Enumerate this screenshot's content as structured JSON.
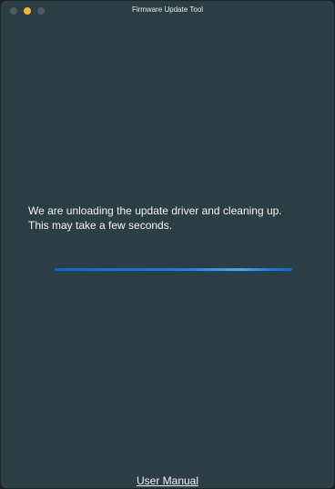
{
  "window": {
    "title": "Firmware Update Tool",
    "background_color": "#2b3e45"
  },
  "traffic_lights": {
    "close_color": "#4d5c62",
    "minimize_color": "#f5b731",
    "zoom_color": "#4d5c62"
  },
  "status": {
    "line1": "We are unloading the update driver and cleaning up.",
    "line2": "This may take a few seconds."
  },
  "progress": {
    "fraction": 1.0,
    "color": "#1b7fe6"
  },
  "footer": {
    "manual_link": "User Manual"
  }
}
